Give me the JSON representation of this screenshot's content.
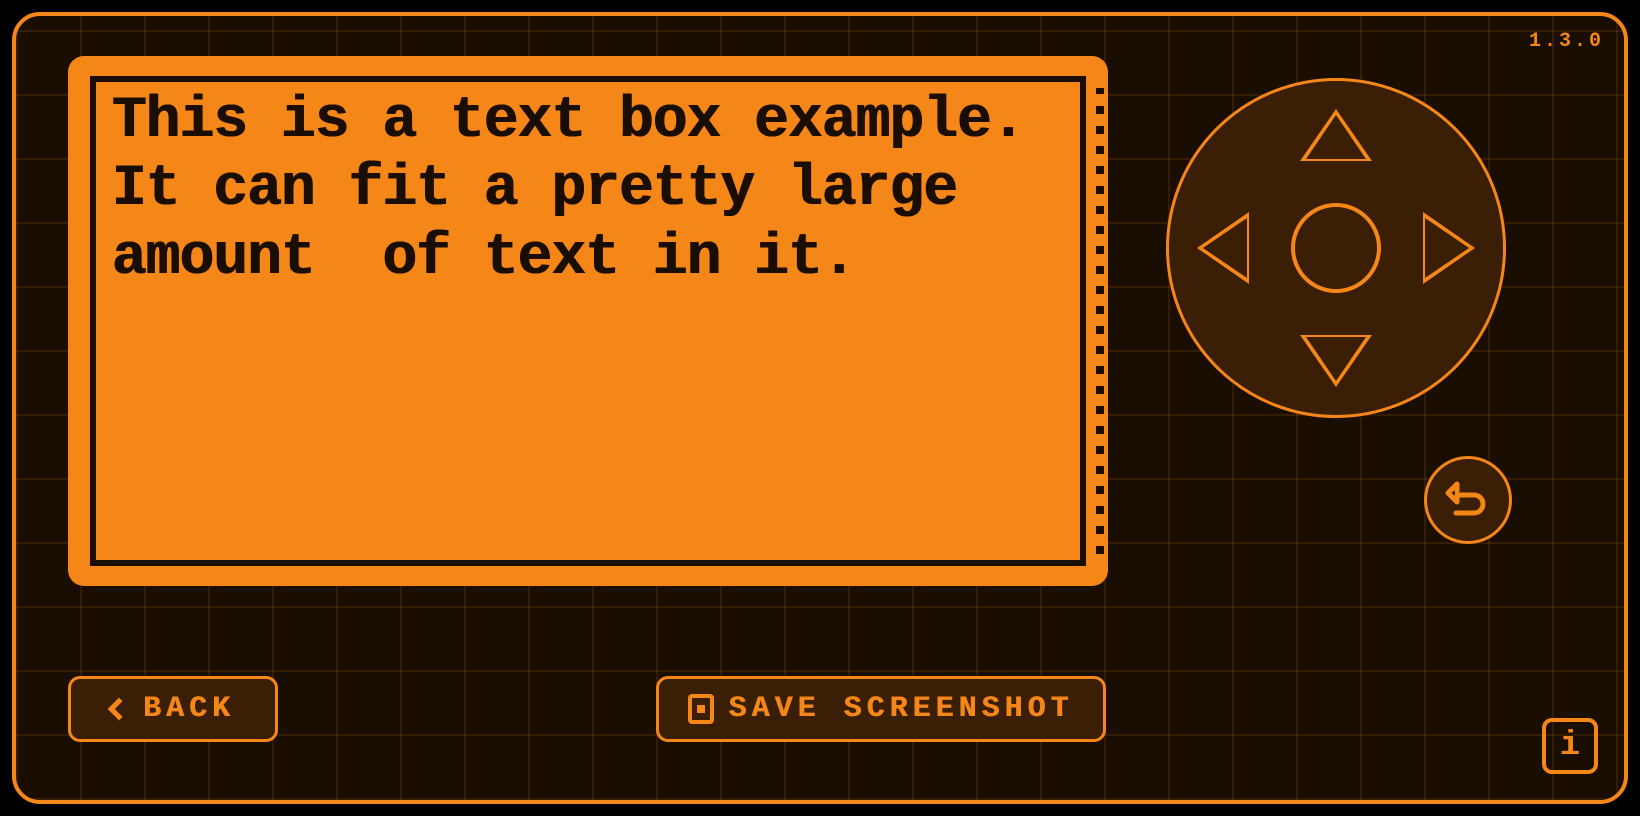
{
  "colors": {
    "accent": "#f58618",
    "panel_dark": "#3a1e05",
    "ink": "#1a0d02"
  },
  "version": "1.3.0",
  "textbox": {
    "content": "This is a text box example. It can fit a pretty large amount  of text in it."
  },
  "buttons": {
    "back_label": "BACK",
    "save_label": "SAVE SCREENSHOT"
  },
  "icons": {
    "back": "chevron-left-icon",
    "save": "save-icon",
    "undo": "undo-icon",
    "info": "info-icon",
    "dpad_up": "triangle-up-icon",
    "dpad_down": "triangle-down-icon",
    "dpad_left": "triangle-left-icon",
    "dpad_right": "triangle-right-icon",
    "dpad_center": "circle-icon"
  },
  "info_glyph": "i"
}
